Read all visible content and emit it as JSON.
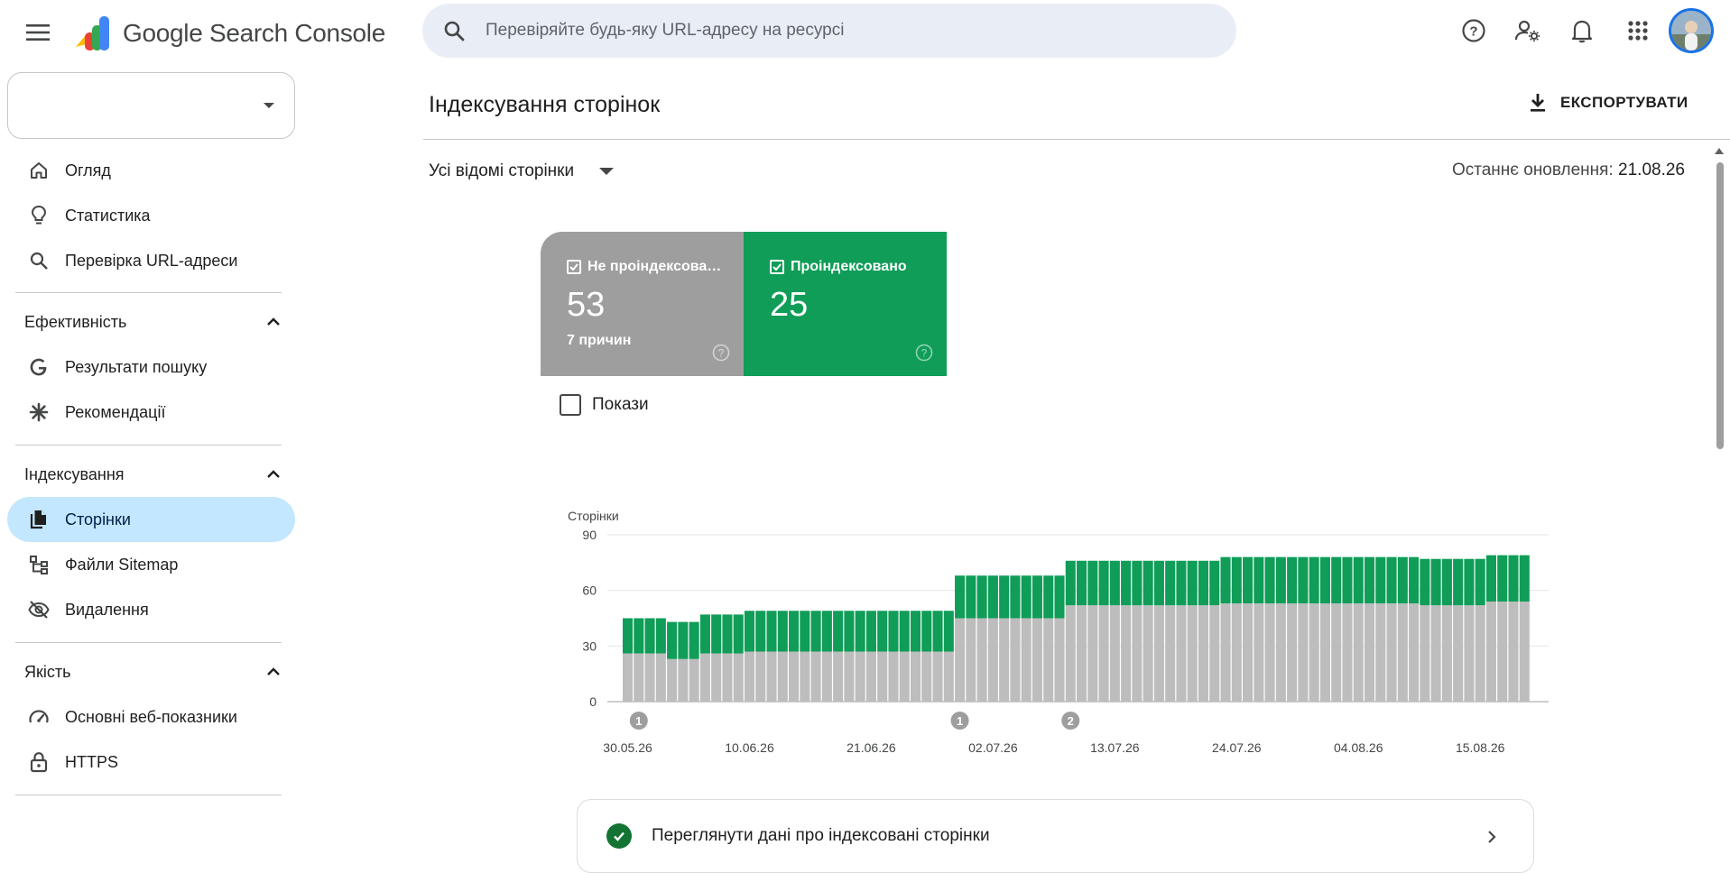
{
  "app": {
    "brand": "Google Search Console",
    "search_placeholder": "Перевіряйте будь-яку URL-адресу на ресурсі",
    "top_icons": [
      "help-icon",
      "manage-accounts-icon",
      "notifications-icon",
      "apps-icon"
    ]
  },
  "sidebar": {
    "property_value": "",
    "items_top": [
      {
        "label": "Огляд",
        "icon": "home-icon"
      },
      {
        "label": "Статистика",
        "icon": "lightbulb-icon"
      },
      {
        "label": "Перевірка URL-адреси",
        "icon": "search-icon"
      }
    ],
    "sections": [
      {
        "title": "Ефективність",
        "items": [
          {
            "label": "Результати пошуку",
            "icon": "google-g-icon"
          },
          {
            "label": "Рекомендації",
            "icon": "asterisk-icon"
          }
        ]
      },
      {
        "title": "Індексування",
        "items": [
          {
            "label": "Сторінки",
            "icon": "pages-icon",
            "active": true
          },
          {
            "label": "Файли Sitemap",
            "icon": "sitemap-icon"
          },
          {
            "label": "Видалення",
            "icon": "visibility-off-icon"
          }
        ]
      },
      {
        "title": "Якість",
        "items": [
          {
            "label": "Основні веб-показники",
            "icon": "speed-icon"
          },
          {
            "label": "HTTPS",
            "icon": "lock-icon"
          }
        ]
      }
    ]
  },
  "main": {
    "title": "Індексування сторінок",
    "export_label": "ЕКСПОРТУВАТИ",
    "filter_label": "Усі відомі сторінки",
    "last_update_label": "Останнє оновлення:",
    "last_update_date": "21.08.26",
    "tiles": [
      {
        "label": "Не проіндексова…",
        "value": "53",
        "sub": "7 причин",
        "checked": true,
        "color": "#9e9e9e"
      },
      {
        "label": "Проіндексовано",
        "value": "25",
        "sub": "",
        "checked": true,
        "color": "#0f9d58"
      }
    ],
    "show_label": "Покази",
    "info_row_label": "Переглянути дані про індексовані сторінки"
  },
  "chart_data": {
    "type": "bar",
    "stacked": true,
    "ylabel": "Сторінки",
    "yticks": [
      0,
      30,
      60,
      90
    ],
    "ylim": [
      0,
      90
    ],
    "xtick_labels": [
      "30.05.26",
      "10.06.26",
      "21.06.26",
      "02.07.26",
      "13.07.26",
      "24.07.26",
      "04.08.26",
      "15.08.26"
    ],
    "grid": true,
    "colors": {
      "not_indexed": "#bdbdbd",
      "indexed": "#0f9d58"
    },
    "series": [
      {
        "name": "Не проіндексова…",
        "values": [
          26,
          26,
          26,
          26,
          23,
          23,
          23,
          26,
          26,
          26,
          26,
          27,
          27,
          27,
          27,
          27,
          27,
          27,
          27,
          27,
          27,
          27,
          27,
          27,
          27,
          27,
          27,
          27,
          27,
          27,
          45,
          45,
          45,
          45,
          45,
          45,
          45,
          45,
          45,
          45,
          52,
          52,
          52,
          52,
          52,
          52,
          52,
          52,
          52,
          52,
          52,
          52,
          52,
          52,
          53,
          53,
          53,
          53,
          53,
          53,
          53,
          53,
          53,
          53,
          53,
          53,
          53,
          53,
          53,
          53,
          53,
          53,
          52,
          52,
          52,
          52,
          52,
          52,
          54,
          54,
          54,
          54
        ]
      },
      {
        "name": "Проіндексовано",
        "values": [
          19,
          19,
          19,
          19,
          20,
          20,
          20,
          21,
          21,
          21,
          21,
          22,
          22,
          22,
          22,
          22,
          22,
          22,
          22,
          22,
          22,
          22,
          22,
          22,
          22,
          22,
          22,
          22,
          22,
          22,
          23,
          23,
          23,
          23,
          23,
          23,
          23,
          23,
          23,
          23,
          24,
          24,
          24,
          24,
          24,
          24,
          24,
          24,
          24,
          24,
          24,
          24,
          24,
          24,
          25,
          25,
          25,
          25,
          25,
          25,
          25,
          25,
          25,
          25,
          25,
          25,
          25,
          25,
          25,
          25,
          25,
          25,
          25,
          25,
          25,
          25,
          25,
          25,
          25,
          25,
          25,
          25
        ]
      }
    ],
    "annotations": [
      {
        "label": "1",
        "bar_index": 1
      },
      {
        "label": "1",
        "bar_index": 30
      },
      {
        "label": "2",
        "bar_index": 40
      }
    ]
  }
}
